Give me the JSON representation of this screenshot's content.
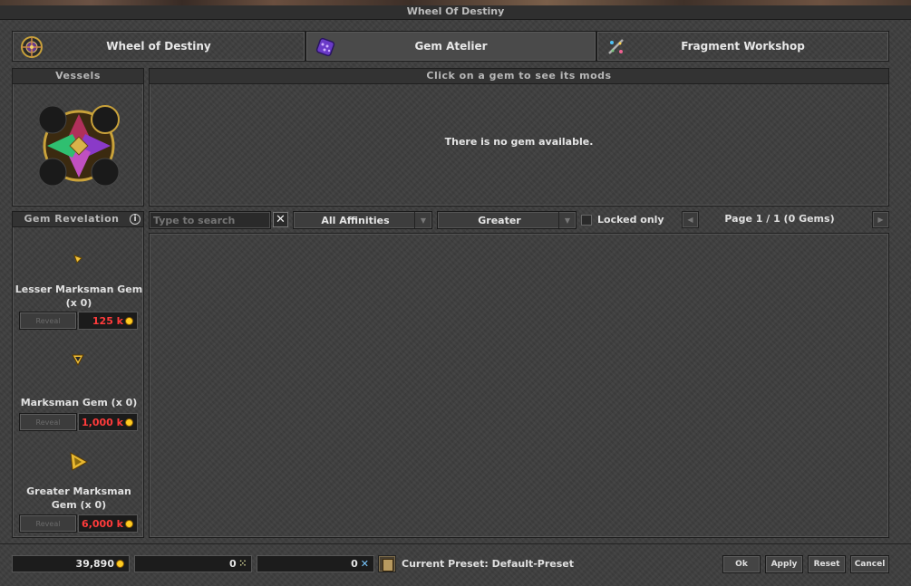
{
  "window": {
    "title": "Wheel Of Destiny"
  },
  "tabs": [
    {
      "label": "Wheel of Destiny",
      "icon": "wheel-icon"
    },
    {
      "label": "Gem Atelier",
      "icon": "gem-atelier-icon"
    },
    {
      "label": "Fragment Workshop",
      "icon": "fragment-workshop-icon"
    }
  ],
  "vessels": {
    "title": "Vessels"
  },
  "mods_panel": {
    "title": "Click on a gem to see its mods",
    "empty_message": "There is no gem available."
  },
  "gem_revelation": {
    "title": "Gem Revelation",
    "gems": [
      {
        "name": "Lesser Marksman Gem (x 0)",
        "reveal_label": "Reveal",
        "price": "125 k"
      },
      {
        "name": "Marksman Gem (x 0)",
        "reveal_label": "Reveal",
        "price": "1,000 k"
      },
      {
        "name": "Greater Marksman Gem (x 0)",
        "reveal_label": "Reveal",
        "price": "6,000 k"
      }
    ]
  },
  "filters": {
    "search_placeholder": "Type to search",
    "affinity_selected": "All Affinities",
    "quality_selected": "Greater",
    "locked_only_label": "Locked only",
    "locked_only_checked": false,
    "page_label": "Page 1 / 1 (0 Gems)"
  },
  "footer": {
    "gold": "39,890",
    "lesser_fragments": "0",
    "greater_fragments": "0",
    "preset_label": "Current Preset: Default-Preset",
    "buttons": {
      "ok": "Ok",
      "apply": "Apply",
      "reset": "Reset",
      "cancel": "Cancel"
    }
  },
  "colors": {
    "price_red": "#ff3b3b",
    "gold_coin": "#ffcc22",
    "panel_bg": "#3e3e3e"
  }
}
